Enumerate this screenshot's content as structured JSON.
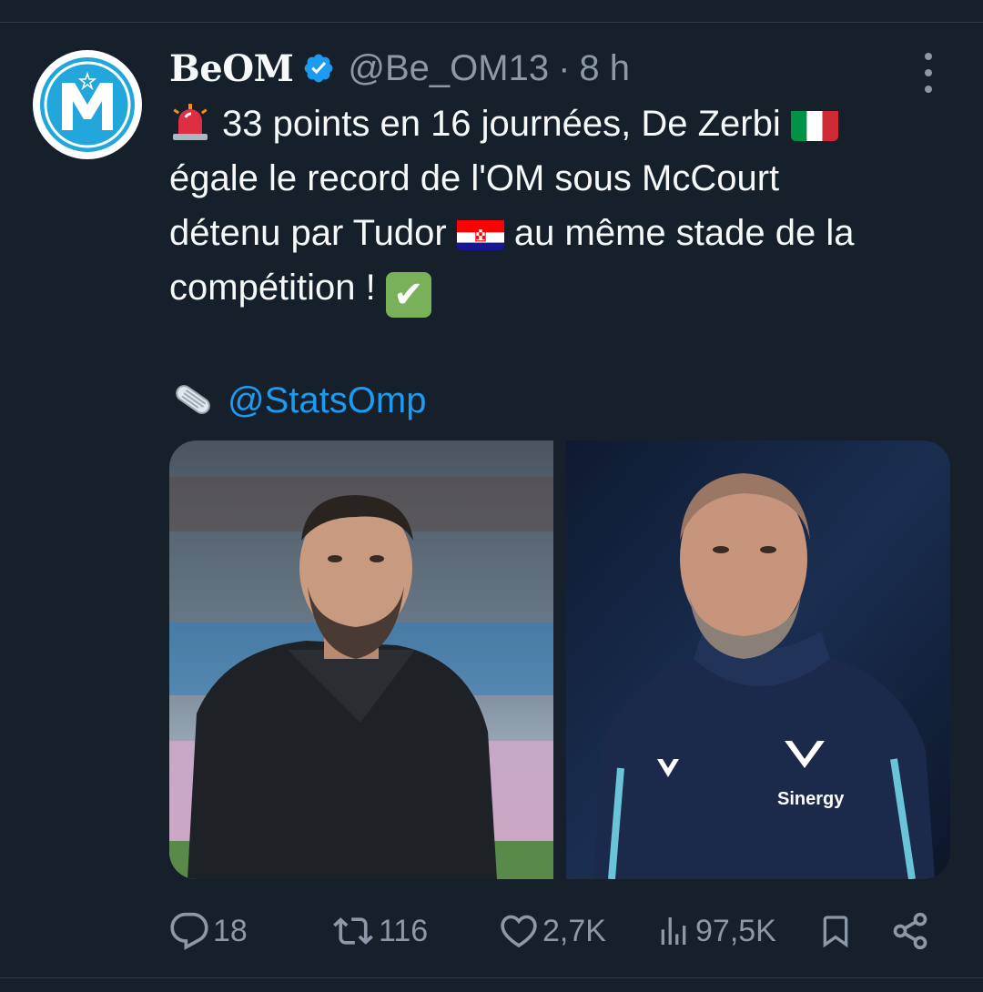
{
  "author": {
    "display_name": "BeOM",
    "handle": "@Be_OM13",
    "separator": "·",
    "time": "8 h",
    "verified": true
  },
  "tweet": {
    "line1": "33 points en 16 journées, De Zerbi",
    "line2": "égale le record de l'OM sous McCourt",
    "line3_a": "détenu par Tudor",
    "line3_b": "au même stade de la",
    "line4": "compétition !",
    "mention": "@StatsOmp",
    "emojis": [
      "rotating-light",
      "italy-flag",
      "croatia-flag",
      "check-mark",
      "newspaper"
    ]
  },
  "media": {
    "photos": [
      {
        "name": "coach-photo-left"
      },
      {
        "name": "coach-photo-right"
      }
    ]
  },
  "actions": {
    "replies": "18",
    "retweets": "116",
    "likes": "2,7K",
    "views": "97,5K"
  },
  "colors": {
    "background": "#15202b",
    "text": "#f7f9f9",
    "secondary": "#8b98a5",
    "accent": "#1d9bf0",
    "brand": "#22a7dd"
  }
}
